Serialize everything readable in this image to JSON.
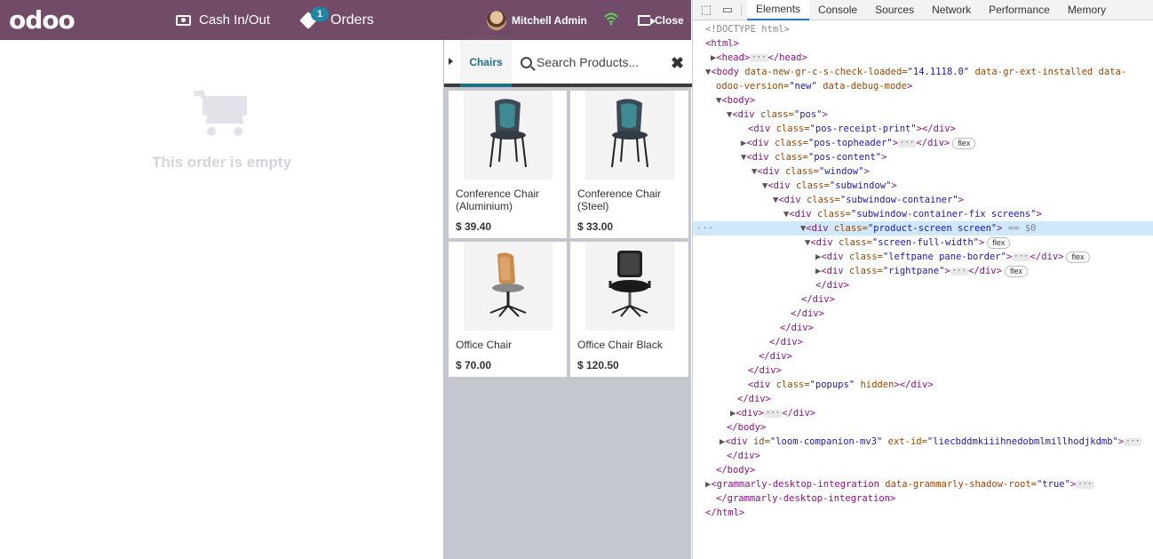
{
  "pos": {
    "logo": "odoo",
    "header": {
      "cash_label": "Cash In/Out",
      "orders_label": "Orders",
      "orders_badge": "1",
      "user_name": "Mitchell Admin",
      "close_label": "Close"
    },
    "order": {
      "empty_message": "This order is empty"
    },
    "category": "Chairs",
    "search_placeholder": "Search Products...",
    "products": [
      {
        "name": "Conference Chair (Aluminium)",
        "price": "$ 39.40"
      },
      {
        "name": "Conference Chair (Steel)",
        "price": "$ 33.00"
      },
      {
        "name": "Office Chair",
        "price": "$ 70.00"
      },
      {
        "name": "Office Chair Black",
        "price": "$ 120.50"
      }
    ],
    "colors": {
      "header": "#714B67",
      "accent": "#1f6e84",
      "badge": "#1F87A8"
    }
  },
  "devtools": {
    "tabs": [
      "Elements",
      "Console",
      "Sources",
      "Network",
      "Performance",
      "Memory"
    ],
    "active_tab": "Elements",
    "dom": {
      "l0": "<!DOCTYPE html>",
      "l1": "<html>",
      "l2a": "<head>",
      "l2b": "</head>",
      "l3a": "<body ",
      "l3b": "data-new-gr-c-s-check-loaded=",
      "l3c": "\"14.1118.0\"",
      "l3d": " data-gr-ext-installed data-",
      "l4a": "odoo-version=",
      "l4b": "\"new\"",
      "l4c": " data-debug-mode",
      "l4d": ">",
      "l5": "<body>",
      "c_pos": "\"pos\"",
      "c_receipt": "\"pos-receipt-print\"",
      "c_topheader": "\"pos-topheader\"",
      "c_content": "\"pos-content\"",
      "c_window": "\"window\"",
      "c_subwindow": "\"subwindow\"",
      "c_container": "\"subwindow-container\"",
      "c_fix": "\"subwindow-container-fix screens\"",
      "c_product": "\"product-screen screen\"",
      "c_full": "\"screen-full-width\"",
      "c_left": "\"leftpane pane-border\"",
      "c_right": "\"rightpane\"",
      "c_popups": "\"popups\"",
      "sel_suffix": " == $0",
      "flex": "flex",
      "hidden": " hidden",
      "loom_id": "\"loom-companion-mv3\"",
      "loom_ext": "\"liecbddmkiiihnedobmlmillhodjkdmb\"",
      "gram_attr": "data-grammarly-shadow-root=",
      "gram_val": "\"true\"",
      "gram_tag": "<grammarly-desktop-integration ",
      "gram_close": "</grammarly-desktop-integration>",
      "div_open": "<div ",
      "div_close": "</div>",
      "class_attr": "class=",
      "id_attr": "id=",
      "extid_attr": " ext-id=",
      "body_close": "</body>",
      "html_close": "</html>",
      "gt": ">",
      "div_simple": "<div>"
    }
  }
}
